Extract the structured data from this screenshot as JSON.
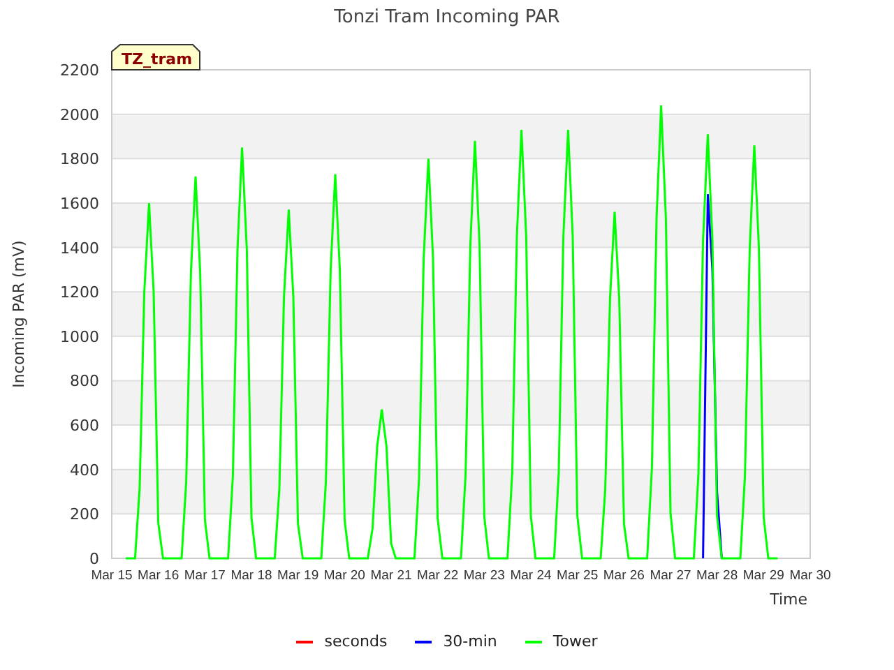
{
  "chart": {
    "tag": "TZ_tram",
    "chart_data": {
      "type": "line",
      "title": "Tonzi Tram Incoming PAR",
      "xlabel": "Time",
      "ylabel": "Incoming PAR (mV)",
      "ylim": [
        0,
        2200
      ],
      "grid": true,
      "legend": "bottom",
      "yticks": [
        0,
        200,
        400,
        600,
        800,
        1000,
        1200,
        1400,
        1600,
        1800,
        2000,
        2200
      ],
      "categories": [
        "Mar 15",
        null,
        null,
        null,
        null,
        null,
        null,
        null,
        null,
        null,
        "Mar 16",
        null,
        null,
        null,
        null,
        null,
        null,
        null,
        null,
        null,
        "Mar 17",
        null,
        null,
        null,
        null,
        null,
        null,
        null,
        null,
        null,
        "Mar 18",
        null,
        null,
        null,
        null,
        null,
        null,
        null,
        null,
        null,
        "Mar 19",
        null,
        null,
        null,
        null,
        null,
        null,
        null,
        null,
        null,
        "Mar 20",
        null,
        null,
        null,
        null,
        null,
        null,
        null,
        null,
        null,
        "Mar 21",
        null,
        null,
        null,
        null,
        null,
        null,
        null,
        null,
        null,
        "Mar 22",
        null,
        null,
        null,
        null,
        null,
        null,
        null,
        null,
        null,
        "Mar 23",
        null,
        null,
        null,
        null,
        null,
        null,
        null,
        null,
        null,
        "Mar 24",
        null,
        null,
        null,
        null,
        null,
        null,
        null,
        null,
        null,
        "Mar 25",
        null,
        null,
        null,
        null,
        null,
        null,
        null,
        null,
        null,
        "Mar 26",
        null,
        null,
        null,
        null,
        null,
        null,
        null,
        null,
        null,
        "Mar 27",
        null,
        null,
        null,
        null,
        null,
        null,
        null,
        null,
        null,
        "Mar 28",
        null,
        null,
        null,
        null,
        null,
        null,
        null,
        null,
        null,
        "Mar 29",
        null,
        null,
        null,
        null,
        null,
        null,
        null,
        null,
        null,
        "Mar 30"
      ],
      "series": [
        {
          "name": "seconds",
          "color": "#ff0000",
          "values": [
            null,
            null,
            null,
            null,
            null,
            null,
            null,
            null,
            null,
            null,
            null,
            null,
            null,
            null,
            null,
            null,
            null,
            null,
            null,
            null,
            null,
            null,
            null,
            null,
            null,
            null,
            null,
            null,
            null,
            null,
            null,
            null,
            null,
            null,
            null,
            null,
            null,
            null,
            null,
            null,
            null,
            null,
            null,
            null,
            null,
            null,
            null,
            null,
            null,
            null,
            null,
            null,
            null,
            null,
            null,
            null,
            null,
            null,
            null,
            null,
            null,
            null,
            null,
            null,
            null,
            null,
            null,
            null,
            null,
            null,
            null,
            null,
            null,
            null,
            null,
            null,
            null,
            null,
            null,
            null,
            null,
            null,
            null,
            null,
            null,
            null,
            null,
            null,
            null,
            null,
            null,
            null,
            null,
            null,
            null,
            null,
            null,
            null,
            null,
            null,
            null,
            null,
            null,
            null,
            null,
            null,
            null,
            null,
            null,
            null,
            null,
            null,
            null,
            null,
            null,
            null,
            null,
            null,
            null,
            null,
            null,
            null,
            null,
            null,
            null,
            null,
            null,
            null,
            null,
            null,
            null,
            null,
            null,
            null,
            null,
            null,
            null,
            null,
            null,
            null,
            null,
            null,
            null,
            null,
            null,
            null,
            null,
            null,
            null,
            null,
            null
          ]
        },
        {
          "name": "30-min",
          "color": "#0000ff",
          "values": [
            null,
            null,
            null,
            null,
            null,
            null,
            null,
            null,
            null,
            null,
            null,
            null,
            null,
            null,
            null,
            null,
            null,
            null,
            null,
            null,
            null,
            null,
            null,
            null,
            null,
            null,
            null,
            null,
            null,
            null,
            null,
            null,
            null,
            null,
            null,
            null,
            null,
            null,
            null,
            null,
            null,
            null,
            null,
            null,
            null,
            null,
            null,
            null,
            null,
            null,
            null,
            null,
            null,
            null,
            null,
            null,
            null,
            null,
            null,
            null,
            null,
            null,
            null,
            null,
            null,
            null,
            null,
            null,
            null,
            null,
            null,
            null,
            null,
            null,
            null,
            null,
            null,
            null,
            null,
            null,
            null,
            null,
            null,
            null,
            null,
            null,
            null,
            null,
            null,
            null,
            null,
            null,
            null,
            null,
            null,
            null,
            null,
            null,
            null,
            null,
            null,
            null,
            null,
            null,
            null,
            null,
            null,
            null,
            null,
            null,
            null,
            null,
            null,
            null,
            null,
            null,
            null,
            null,
            null,
            null,
            null,
            null,
            null,
            null,
            null,
            null,
            null,
            0,
            1640,
            1300,
            300,
            0,
            null,
            null,
            null,
            null,
            null,
            null,
            null,
            null,
            null,
            null,
            null,
            null,
            null,
            null,
            null,
            null,
            null,
            null,
            null
          ]
        },
        {
          "name": "Tower",
          "color": "#00ff00",
          "values": [
            null,
            null,
            null,
            0,
            0,
            0,
            320,
            1200,
            1600,
            1200,
            160,
            0,
            0,
            0,
            0,
            0,
            344,
            1290,
            1720,
            1290,
            172,
            0,
            0,
            0,
            0,
            0,
            370,
            1388,
            1850,
            1388,
            185,
            0,
            0,
            0,
            0,
            0,
            314,
            1178,
            1570,
            1178,
            157,
            0,
            0,
            0,
            0,
            0,
            346,
            1298,
            1730,
            1298,
            173,
            0,
            0,
            0,
            0,
            0,
            134,
            503,
            670,
            503,
            67,
            0,
            0,
            0,
            0,
            0,
            360,
            1350,
            1800,
            1350,
            180,
            0,
            0,
            0,
            0,
            0,
            376,
            1410,
            1880,
            1410,
            188,
            0,
            0,
            0,
            0,
            0,
            386,
            1448,
            1930,
            1448,
            193,
            0,
            0,
            0,
            0,
            0,
            386,
            1448,
            1930,
            1448,
            193,
            0,
            0,
            0,
            0,
            0,
            312,
            1170,
            1560,
            1170,
            156,
            0,
            0,
            0,
            0,
            0,
            408,
            1530,
            2040,
            1530,
            204,
            0,
            0,
            0,
            0,
            0,
            382,
            1433,
            1910,
            1433,
            191,
            0,
            0,
            0,
            0,
            0,
            372,
            1395,
            1860,
            1395,
            186,
            0,
            0,
            0,
            null,
            null,
            null,
            null,
            null,
            null,
            null
          ]
        }
      ]
    }
  }
}
